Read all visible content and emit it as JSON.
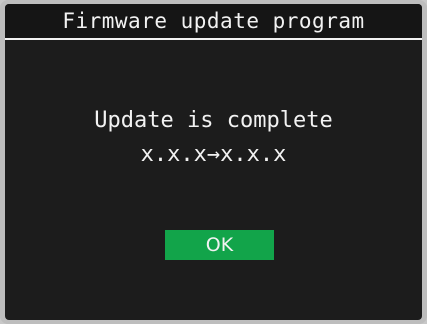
{
  "header": {
    "title": "Firmware update program"
  },
  "dialog": {
    "message": "Update is complete",
    "version_text": "x.x.x→x.x.x",
    "ok_label": "OK"
  },
  "colors": {
    "screen_background": "#1c1c1c",
    "text": "#f2f2f2",
    "ok_button": "#12a44a"
  }
}
